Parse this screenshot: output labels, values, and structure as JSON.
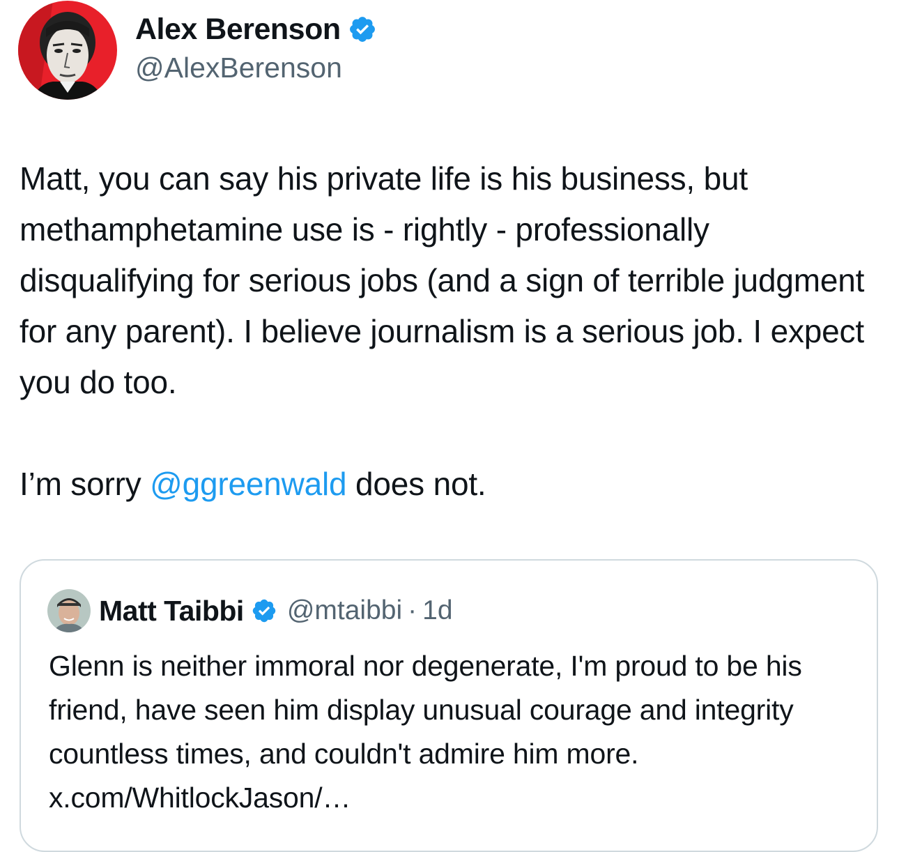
{
  "author": {
    "display_name": "Alex Berenson",
    "handle": "@AlexBerenson",
    "verified": true,
    "avatar_icon": "portrait-avatar"
  },
  "tweet": {
    "paragraph1": "Matt, you can say his private life is his business, but methamphetamine use is - rightly - professionally disqualifying for serious jobs (and a sign of terrible judgment for any parent). I believe journalism is a serious job. I expect you do too.",
    "paragraph2_before": "I’m sorry ",
    "paragraph2_mention": "@ggreenwald",
    "paragraph2_after": " does not."
  },
  "quoted_tweet": {
    "display_name": "Matt Taibbi",
    "handle": "@mtaibbi",
    "separator": "·",
    "time": "1d",
    "verified": true,
    "text": "Glenn is neither immoral nor degenerate, I'm proud to be his friend, have seen him display unusual courage and integrity countless times, and couldn't admire him more. x.com/WhitlockJason/…"
  },
  "colors": {
    "text": "#0f1419",
    "secondary": "#536471",
    "link": "#1d9bf0",
    "verified_badge": "#1d9bf0",
    "border": "#cfd9de"
  }
}
